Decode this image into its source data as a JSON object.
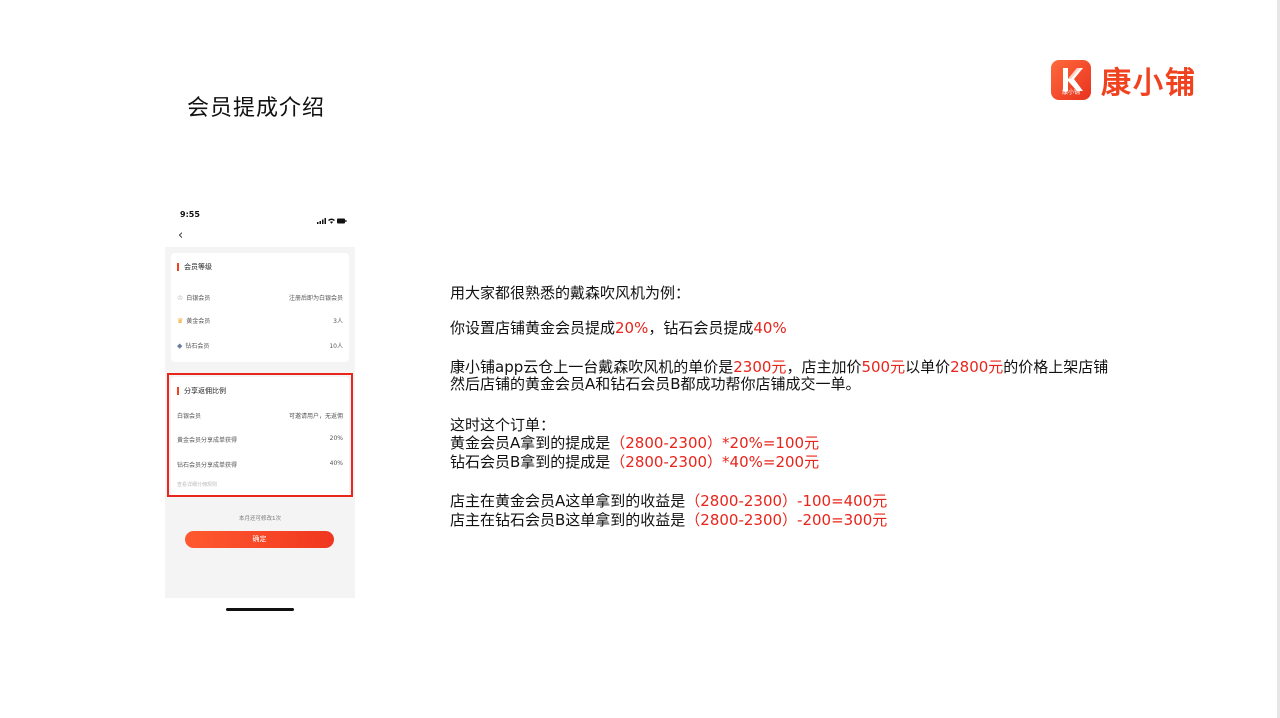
{
  "slide": {
    "title": "会员提成介绍"
  },
  "logo": {
    "text": "康小铺",
    "mark_small": "康小铺"
  },
  "phone": {
    "time": "9:55",
    "member_levels": {
      "title": "会员等级",
      "rows": [
        {
          "label": "白银会员",
          "value": "注册后即为白银会员"
        },
        {
          "label": "黄金会员",
          "value": "3人"
        },
        {
          "label": "钻石会员",
          "value": "10人"
        }
      ]
    },
    "share_ratio": {
      "title": "分享返佣比例",
      "rows": [
        {
          "label": "白银会员",
          "value": "可邀请用户，无返佣"
        },
        {
          "label": "黄金会员分享成单获得",
          "value": "20%"
        },
        {
          "label": "钻石会员分享成单获得",
          "value": "40%"
        }
      ],
      "link": "查看详细分佣规则"
    },
    "remaining_text": "本月还可修改1次",
    "confirm_label": "确定"
  },
  "content": {
    "intro": "用大家都很熟悉的戴森吹风机为例：",
    "setting": {
      "prefix": "你设置店铺黄金会员提成",
      "gold_rate": "20%",
      "middle": "，钻石会员提成",
      "diamond_rate": "40%"
    },
    "price_line": {
      "p1": "康小铺app云仓上一台戴森吹风机的单价是",
      "unit_price": "2300元",
      "p2": "，店主加价",
      "markup": "500元",
      "p3": "以单价",
      "sell_price": "2800元",
      "p4": "的价格上架店铺"
    },
    "deal_line": "然后店铺的黄金会员A和钻石会员B都成功帮你店铺成交一单。",
    "order_heading": "这时这个订单：",
    "gold_commission": {
      "label": "黄金会员A拿到的提成是",
      "formula": "（2800-2300）*20%=100元"
    },
    "diamond_commission": {
      "label": "钻石会员B拿到的提成是",
      "formula": "（2800-2300）*40%=200元"
    },
    "owner_gold": {
      "label": "店主在黄金会员A这单拿到的收益是",
      "formula": "（2800-2300）-100=400元"
    },
    "owner_diamond": {
      "label": "店主在钻石会员B这单拿到的收益是",
      "formula": "（2800-2300）-200=300元"
    }
  },
  "colors": {
    "accent": "#e8241b",
    "brand": "#f0421f"
  }
}
